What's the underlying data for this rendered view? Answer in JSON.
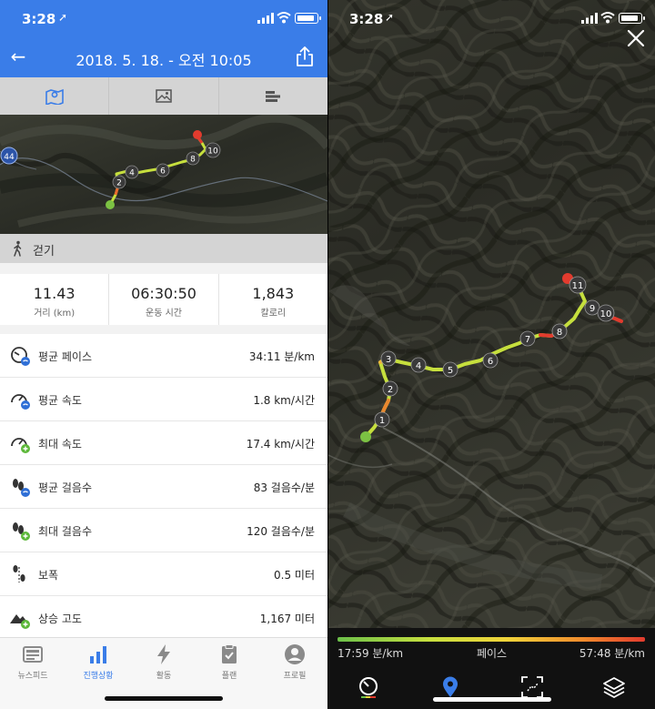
{
  "left": {
    "status": {
      "time": "3:28",
      "loc_glyph": "➚"
    },
    "header": {
      "title": "2018. 5. 18. - 오전 10:05",
      "back_glyph": "←"
    },
    "tabs": [
      {
        "name": "map-tab",
        "icon": "map-icon",
        "active": true
      },
      {
        "name": "photo-tab",
        "icon": "photo-icon",
        "active": false
      },
      {
        "name": "splits-tab",
        "icon": "bar-list-icon",
        "active": false
      }
    ],
    "minimap": {
      "road_label": "44",
      "markers": [
        "2",
        "4",
        "6",
        "8",
        "10"
      ]
    },
    "activity": {
      "label": "걷기"
    },
    "summary": [
      {
        "value": "11.43",
        "label": "거리 (km)"
      },
      {
        "value": "06:30:50",
        "label": "운동 시간"
      },
      {
        "value": "1,843",
        "label": "칼로리"
      }
    ],
    "stats": [
      {
        "name": "평균 페이스",
        "value": "34:11 분/km",
        "icon": "pace-avg-icon"
      },
      {
        "name": "평균 속도",
        "value": "1.8 km/시간",
        "icon": "speed-avg-icon"
      },
      {
        "name": "최대 속도",
        "value": "17.4 km/시간",
        "icon": "speed-max-icon"
      },
      {
        "name": "평균 걸음수",
        "value": "83 걸음수/분",
        "icon": "steps-avg-icon"
      },
      {
        "name": "최대 걸음수",
        "value": "120 걸음수/분",
        "icon": "steps-max-icon"
      },
      {
        "name": "보폭",
        "value": "0.5 미터",
        "icon": "stride-icon"
      },
      {
        "name": "상승 고도",
        "value": "1,167 미터",
        "icon": "elevation-gain-icon"
      }
    ],
    "nav": [
      {
        "label": "뉴스피드",
        "icon": "newsfeed-icon",
        "active": false
      },
      {
        "label": "진행상황",
        "icon": "progress-icon",
        "active": true
      },
      {
        "label": "활동",
        "icon": "activity-icon",
        "active": false
      },
      {
        "label": "플랜",
        "icon": "plan-icon",
        "active": false
      },
      {
        "label": "프로필",
        "icon": "profile-icon",
        "active": false
      }
    ]
  },
  "right": {
    "status": {
      "time": "3:28",
      "loc_glyph": "➚"
    },
    "map_markers": [
      "1",
      "2",
      "3",
      "4",
      "5",
      "6",
      "7",
      "8",
      "9",
      "10",
      "11"
    ],
    "legend": {
      "min": "17:59 분/km",
      "mid": "페이스",
      "max": "57:48 분/km"
    },
    "tools": [
      "pace-gauge-icon",
      "location-pin-icon",
      "fit-route-icon",
      "layers-icon"
    ]
  },
  "colors": {
    "header_blue": "#3a7de8",
    "start_green": "#7cc243",
    "end_red": "#e23b2e"
  }
}
